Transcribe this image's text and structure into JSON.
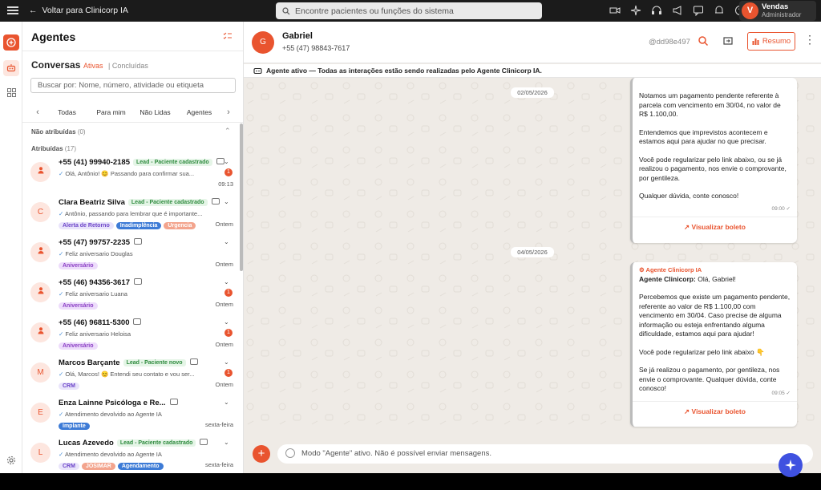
{
  "topbar": {
    "back_label": "Voltar para Clinicorp IA",
    "search_placeholder": "Encontre pacientes ou funções do sistema",
    "user": {
      "initial": "V",
      "name": "Vendas",
      "role": "Administrador"
    }
  },
  "list": {
    "title": "Agentes",
    "conversations_title": "Conversas",
    "status_tabs": [
      "Ativas",
      "Concluídas"
    ],
    "search_placeholder": "Buscar por: Nome, número, atividade ou etiqueta",
    "filter_tabs": [
      "Todas",
      "Para mim",
      "Não Lidas",
      "Agentes"
    ],
    "unassigned": {
      "label": "Não atribuídas",
      "count": "(0)"
    },
    "assigned": {
      "label": "Atribuídas",
      "count": "(17)"
    },
    "items": [
      {
        "avatar": "",
        "name": "+55 (41) 99940-2185",
        "tag": "Lead - Paciente cadastrado",
        "message": "Olá, Antônio! 😊 Passando para confirmar sua...",
        "unread": "1",
        "time": "09:13",
        "chips": []
      },
      {
        "avatar": "C",
        "name": "Clara Beatriz Silva",
        "tag": "Lead - Paciente cadastrado",
        "message": "Antônio, passando para lembrar que é importante...",
        "unread": "",
        "time": "Ontem",
        "chips": [
          "Alerta de Retorno",
          "Inadimplência",
          "Urgencia"
        ]
      },
      {
        "avatar": "",
        "name": "+55 (47) 99757-2235",
        "tag": "",
        "message": "Feliz aniversario Douglas",
        "unread": "",
        "time": "Ontem",
        "chips": [
          "Aniversário"
        ]
      },
      {
        "avatar": "",
        "name": "+55 (46) 94356-3617",
        "tag": "",
        "message": "Feliz aniversario Luana",
        "unread": "1",
        "time": "Ontem",
        "chips": [
          "Aniversário"
        ]
      },
      {
        "avatar": "",
        "name": "+55 (46) 96811-5300",
        "tag": "",
        "message": "Feliz aniversario Heloisa",
        "unread": "1",
        "time": "Ontem",
        "chips": [
          "Aniversário"
        ]
      },
      {
        "avatar": "M",
        "name": "Marcos Barçante",
        "tag": "Lead - Paciente novo",
        "message": "Olá, Marcos! 😊 Entendi seu contato e vou ser...",
        "unread": "1",
        "time": "Ontem",
        "chips": [
          "CRM"
        ]
      },
      {
        "avatar": "E",
        "name": "Enza Lainne Psicóloga e Re...",
        "tag": "",
        "message": "Atendimento devolvido ao Agente IA",
        "unread": "",
        "time": "sexta-feira",
        "chips": [
          "Implante"
        ]
      },
      {
        "avatar": "L",
        "name": "Lucas Azevedo",
        "tag": "Lead - Paciente cadastrado",
        "message": "Atendimento devolvido ao Agente IA",
        "unread": "",
        "time": "sexta-feira",
        "chips": [
          "CRM",
          "JOSIMAR",
          "Agendamento"
        ]
      }
    ]
  },
  "chat": {
    "contact": {
      "initial": "G",
      "name": "Gabriel",
      "phone": "+55 (47) 98843-7617",
      "hash": "@dd98e497"
    },
    "summary_label": "Resumo",
    "banner": "Agente ativo — Todas as interações estão sendo realizadas pelo Agente Clinicorp IA.",
    "dates": [
      "02/05/2026",
      "04/05/2026"
    ],
    "message1": {
      "paragraphs": [
        "Notamos um pagamento pendente referente à parcela com vencimento em 30/04, no valor de R$ 1.100,00.",
        "Entendemos que imprevistos acontecem e estamos aqui para ajudar no que precisar.",
        "Você pode regularizar pelo link abaixo, ou se já realizou o pagamento, nos envie o comprovante, por gentileza.",
        "Qualquer dúvida, conte conosco!"
      ],
      "time": "09:00",
      "link": "Visualizar boleto"
    },
    "message2": {
      "sender": "Agente Clinicorp IA",
      "greeting_bold": "Agente Clinicorp:",
      "greeting": " Olá, Gabriel!",
      "paragraphs": [
        "Percebemos que existe um pagamento pendente, referente ao valor de R$ 1.100,00 com vencimento em 30/04. Caso precise de alguma informação ou esteja enfrentando alguma dificuldade, estamos aqui para ajudar!",
        "Você pode regularizar pelo link abaixo 👇",
        "Se já realizou o pagamento, por gentileza, nos envie o comprovante. Qualquer dúvida, conte conosco!"
      ],
      "time": "09:05",
      "link": "Visualizar boleto"
    },
    "composer_placeholder": "Modo \"Agente\" ativo. Não é possível enviar mensagens."
  }
}
